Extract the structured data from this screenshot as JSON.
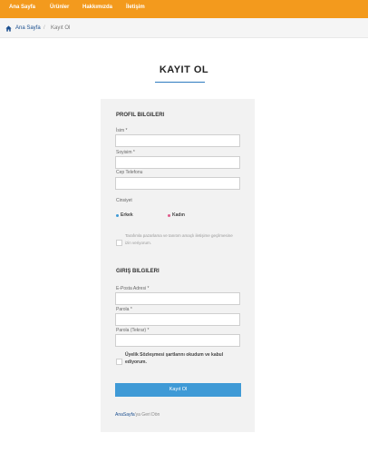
{
  "nav": {
    "items": [
      {
        "label": "Ana Sayfa"
      },
      {
        "label": "Ürünler"
      },
      {
        "label": "Hakkımızda"
      },
      {
        "label": "İletişim"
      }
    ],
    "bar_color": "#f39a1d"
  },
  "breadcrumb": {
    "home_icon": "home-icon",
    "home": "Ana Sayfa",
    "separator": "/",
    "current": "Kayıt Ol"
  },
  "page": {
    "title": "KAYIT OL",
    "accent_color": "#2e7bbf"
  },
  "profile_section": {
    "title": "PROFIL BILGILERI",
    "name_label": "İsim *",
    "name_value": "",
    "surname_label": "Soyisim *",
    "surname_value": "",
    "phone_label": "Cep Telefonu",
    "phone_value": "",
    "gender_label": "Cinsiyet",
    "gender_male": "Erkek",
    "gender_female": "Kadın",
    "marketing_consent": "Tarafımla pazarlama ve tanıtım amaçlı iletişime geçilmesine izin veriyorum."
  },
  "login_section": {
    "title": "GIRIŞ BILGILERI",
    "email_label": "E-Posta Adresi *",
    "email_value": "",
    "password_label": "Parola *",
    "password_value": "",
    "password_repeat_label": "Parola (Tekrar) *",
    "password_repeat_value": "",
    "agreement": "Üyelik Sözleşmesi şartlarını okudum ve kabul ediyorum."
  },
  "actions": {
    "submit_label": "Kayıt Ol",
    "submit_color": "#3f9ad6",
    "back_link": "AnaSayfa",
    "back_suffix": "'ya Geri Dön"
  }
}
